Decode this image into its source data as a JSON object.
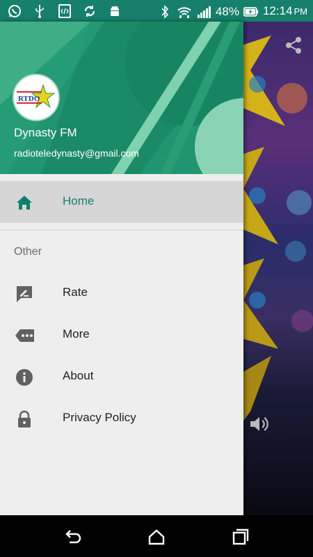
{
  "status_bar": {
    "battery_percent": "48%",
    "time": "12:14",
    "ampm": "PM",
    "icons": [
      "whatsapp-icon",
      "usb-icon",
      "developer-icon",
      "sync-icon",
      "android-icon",
      "bluetooth-icon",
      "wifi-icon",
      "signal-icon",
      "battery-icon"
    ]
  },
  "drawer": {
    "header": {
      "name": "Dynasty FM",
      "email": "radioteledynasty@gmail.com",
      "logo_text": "RTDO"
    },
    "items_primary": [
      {
        "label": "Home",
        "icon": "home-icon",
        "active": true
      }
    ],
    "section_title": "Other",
    "items_other": [
      {
        "label": "Rate",
        "icon": "rate-icon"
      },
      {
        "label": "More",
        "icon": "more-icon"
      },
      {
        "label": "About",
        "icon": "info-icon"
      },
      {
        "label": "Privacy Policy",
        "icon": "lock-icon"
      }
    ]
  },
  "colors": {
    "primary": "#16806a",
    "accent_text": "#11806a",
    "drawer_bg": "#eeeeee"
  }
}
